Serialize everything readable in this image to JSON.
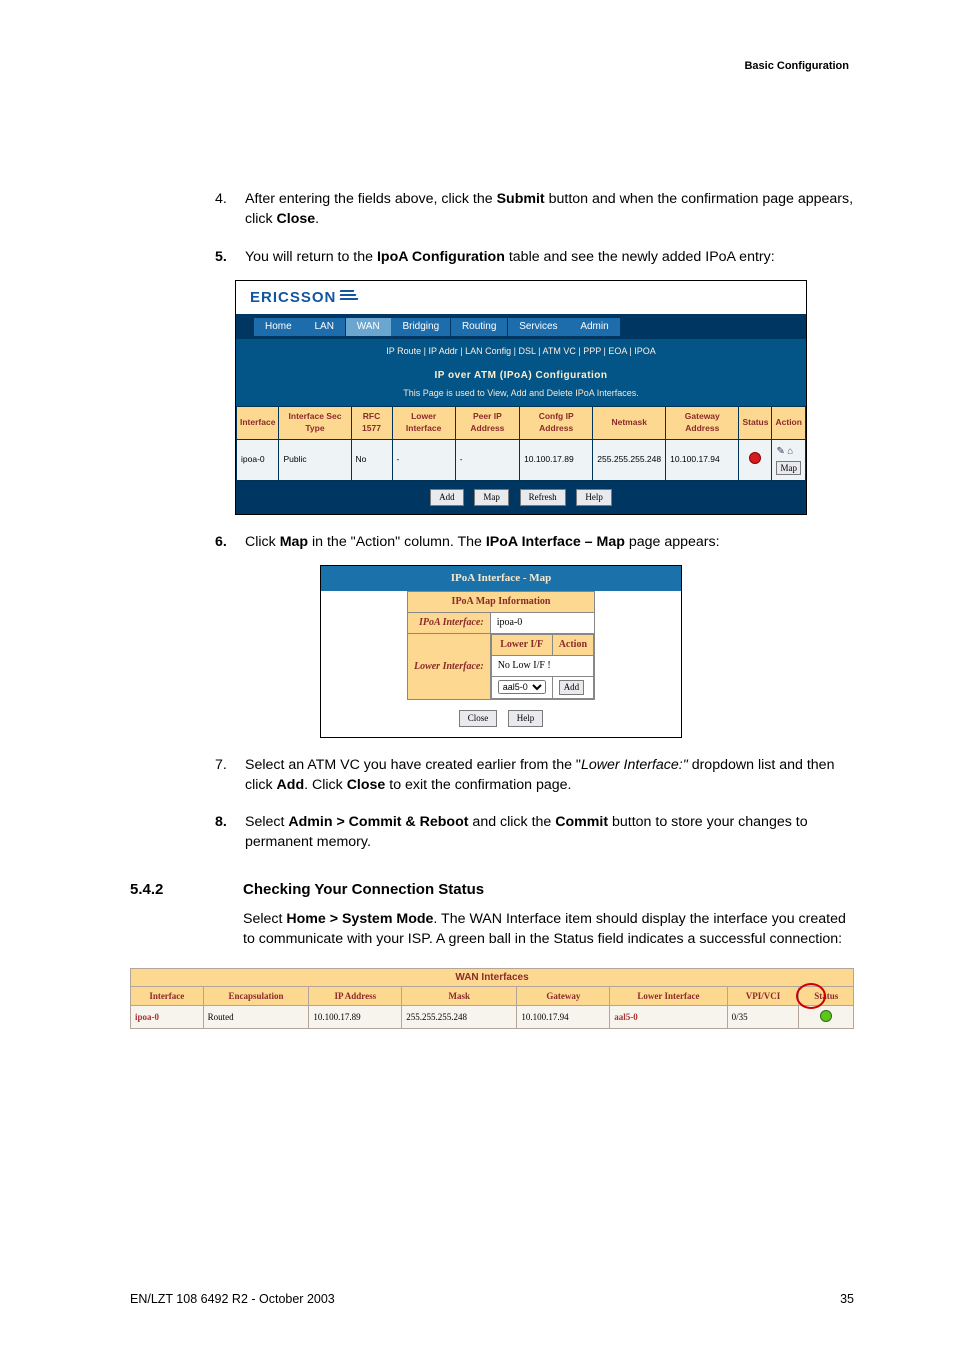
{
  "header": {
    "section": "Basic Configuration"
  },
  "steps": {
    "s4": {
      "num": "4.",
      "text_before": "After entering the fields above, click the ",
      "bold1": "Submit",
      "text_mid": " button and when the confirmation page appears, click ",
      "bold2": "Close",
      "text_after": "."
    },
    "s5": {
      "num": "5.",
      "text_before": "You will return to the ",
      "bold1": "IpoA Configuration",
      "text_after": " table and see the newly added IPoA entry:"
    },
    "s6": {
      "num": "6.",
      "text_before": "Click ",
      "bold1": "Map",
      "text_mid": " in the \"Action\" column. The ",
      "bold2": "IPoA Interface – Map",
      "text_after": " page appears:"
    },
    "s7": {
      "num": "7.",
      "text_before": "Select an ATM VC you have created earlier from the \"",
      "italic1": "Lower Interface:\"",
      "text_mid": " dropdown list and then click ",
      "bold1": "Add",
      "text_mid2": ". Click ",
      "bold2": "Close",
      "text_after": " to exit the confirmation page."
    },
    "s8": {
      "num": "8.",
      "text_before": "Select ",
      "bold1": "Admin > Commit & Reboot",
      "text_mid": " and click the ",
      "bold2": "Commit",
      "text_after": " button to store your changes to permanent memory."
    }
  },
  "router": {
    "brand": "ERICSSON",
    "nav": [
      "Home",
      "LAN",
      "WAN",
      "Bridging",
      "Routing",
      "Services",
      "Admin"
    ],
    "subnav": "IP Route  |  IP Addr  |  LAN Config  |  DSL  |  ATM VC  |  PPP  |  EOA  |  IPOA",
    "page_title": "IP over ATM (IPoA) Configuration",
    "page_subtitle": "This Page is used to View, Add and Delete IPoA Interfaces.",
    "columns": [
      "Interface",
      "Interface Sec Type",
      "RFC 1577",
      "Lower Interface",
      "Peer IP Address",
      "Confg IP Address",
      "Netmask",
      "Gateway Address",
      "Status",
      "Action"
    ],
    "row": {
      "iface": "ipoa-0",
      "sectype": "Public",
      "rfc": "No",
      "lower": "-",
      "peer": "-",
      "confip": "10.100.17.89",
      "netmask": "255.255.255.248",
      "gw": "10.100.17.94"
    },
    "buttons": {
      "add": "Add",
      "map": "Map",
      "refresh": "Refresh",
      "help": "Help"
    },
    "map_btn": "Map"
  },
  "ipoamap": {
    "title": "IPoA Interface - Map",
    "info_h": "IPoA Map Information",
    "iface_label": "IPoA Interface:",
    "iface_value": "ipoa-0",
    "lower_label": "Lower Interface:",
    "tbl_h1": "Lower I/F",
    "tbl_h2": "Action",
    "no_low": "No Low I/F !",
    "select_val": "aal5-0",
    "add_btn": "Add",
    "close_btn": "Close",
    "help_btn": "Help"
  },
  "section": {
    "number": "5.4.2",
    "title": "Checking Your Connection Status",
    "body_before": "Select ",
    "body_bold": "Home > System Mode",
    "body_after": ". The WAN Interface item should display the interface you created to communicate with your ISP. A green ball in the Status field indicates a successful connection:"
  },
  "wan": {
    "caption": "WAN Interfaces",
    "cols": [
      "Interface",
      "Encapsulation",
      "IP Address",
      "Mask",
      "Gateway",
      "Lower Interface",
      "VPI/VCI",
      "Status"
    ],
    "row": {
      "iface": "ipoa-0",
      "encap": "Routed",
      "ip": "10.100.17.89",
      "mask": "255.255.255.248",
      "gw": "10.100.17.94",
      "lower": "aal5-0",
      "vpi": "0/35"
    }
  },
  "footer": {
    "left": "EN/LZT 108 6492 R2 - October 2003",
    "right": "35"
  }
}
